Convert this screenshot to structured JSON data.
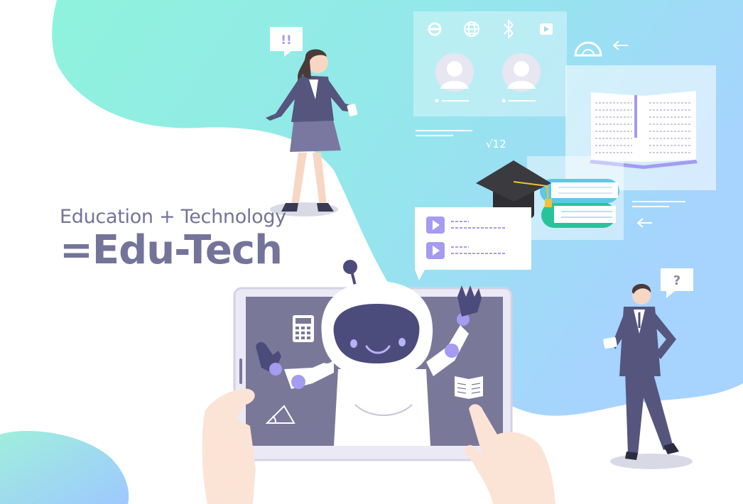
{
  "headline": {
    "subtitle": "Education + Technology",
    "title": "=Edu-Tech"
  },
  "bubbles": {
    "teacher": "!!",
    "student": "?"
  },
  "math": {
    "sqrt": "√12"
  },
  "colors": {
    "mint": "#8ef3dc",
    "sky": "#a7dbff",
    "ink": "#74749a",
    "navy": "#4b4b7c",
    "lavender": "#a59bf0"
  },
  "icons": [
    "internet-explorer-icon",
    "globe-icon",
    "bluetooth-icon",
    "play-icon",
    "protractor-icon",
    "back-arrow-icon",
    "calculator-icon",
    "book-icon",
    "triangle-ruler-icon",
    "graduation-cap-icon"
  ]
}
